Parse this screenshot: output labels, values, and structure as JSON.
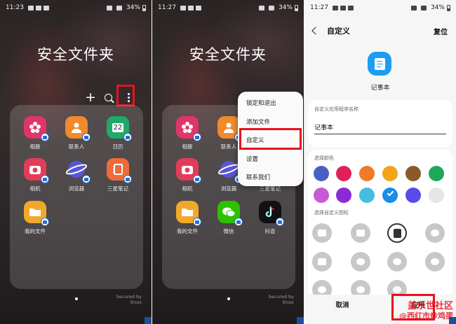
{
  "panel1": {
    "status": {
      "time": "11:23",
      "battery": "34%"
    },
    "title": "安全文件夹",
    "apps": [
      {
        "label": "相册",
        "color": "#e0356a",
        "icon": "flower-icon"
      },
      {
        "label": "联系人",
        "color": "#f08a2c",
        "icon": "person-icon"
      },
      {
        "label": "日历",
        "color": "#1faa6a",
        "icon": "calendar-icon",
        "glyph": "22"
      },
      {
        "label": "相机",
        "color": "#e23d58",
        "icon": "camera-icon"
      },
      {
        "label": "浏览器",
        "color": "#5856d6",
        "icon": "planet-icon"
      },
      {
        "label": "三星笔记",
        "color": "#ef6b3a",
        "icon": "notebook-icon"
      },
      {
        "label": "我的文件",
        "color": "#f2a82a",
        "icon": "folder-icon"
      }
    ],
    "knox": "Secured by Knox"
  },
  "panel2": {
    "status": {
      "time": "11:27",
      "battery": "34%"
    },
    "title": "安全文件夹",
    "apps": [
      {
        "label": "相册",
        "color": "#e0356a",
        "icon": "flower-icon"
      },
      {
        "label": "联系人",
        "color": "#f08a2c",
        "icon": "person-icon"
      },
      {
        "label": "相机",
        "color": "#e23d58",
        "icon": "camera-icon"
      },
      {
        "label": "浏览器",
        "color": "#5856d6",
        "icon": "planet-icon"
      },
      {
        "label": "三星笔记",
        "color": "#ef6b3a",
        "icon": "notebook-icon"
      },
      {
        "label": "我的文件",
        "color": "#f2a82a",
        "icon": "folder-icon"
      },
      {
        "label": "微信",
        "color": "#2dc100",
        "icon": "wechat-icon"
      },
      {
        "label": "抖音",
        "color": "#111111",
        "icon": "tiktok-icon"
      }
    ],
    "menu": [
      "锁定和退出",
      "添加文件",
      "自定义",
      "设置",
      "联系我们"
    ],
    "knox": "Secured by Knox"
  },
  "panel3": {
    "status": {
      "time": "11:27",
      "battery": "34%"
    },
    "header": {
      "title": "自定义",
      "reset": "复位"
    },
    "app_name": "记事本",
    "name_section_label": "自定义应用程序名称",
    "name_value": "记事本",
    "color_section_label": "选择颜色",
    "colors": [
      "#4a5fc4",
      "#e0205a",
      "#f07a2a",
      "#f2a41a",
      "#8a5a2a",
      "#1ea85a",
      "#c85ad6",
      "#8a2ad6",
      "#46bde0",
      "#1a8de8",
      "#5a4ae8",
      "#e6e6e6"
    ],
    "selected_color_index": 9,
    "icon_section_label": "选择自定义图标",
    "buttons": {
      "cancel": "取消",
      "apply": "应用"
    }
  },
  "watermark": [
    "盖乐世社区",
    "@西红市炒鸡蛋"
  ]
}
